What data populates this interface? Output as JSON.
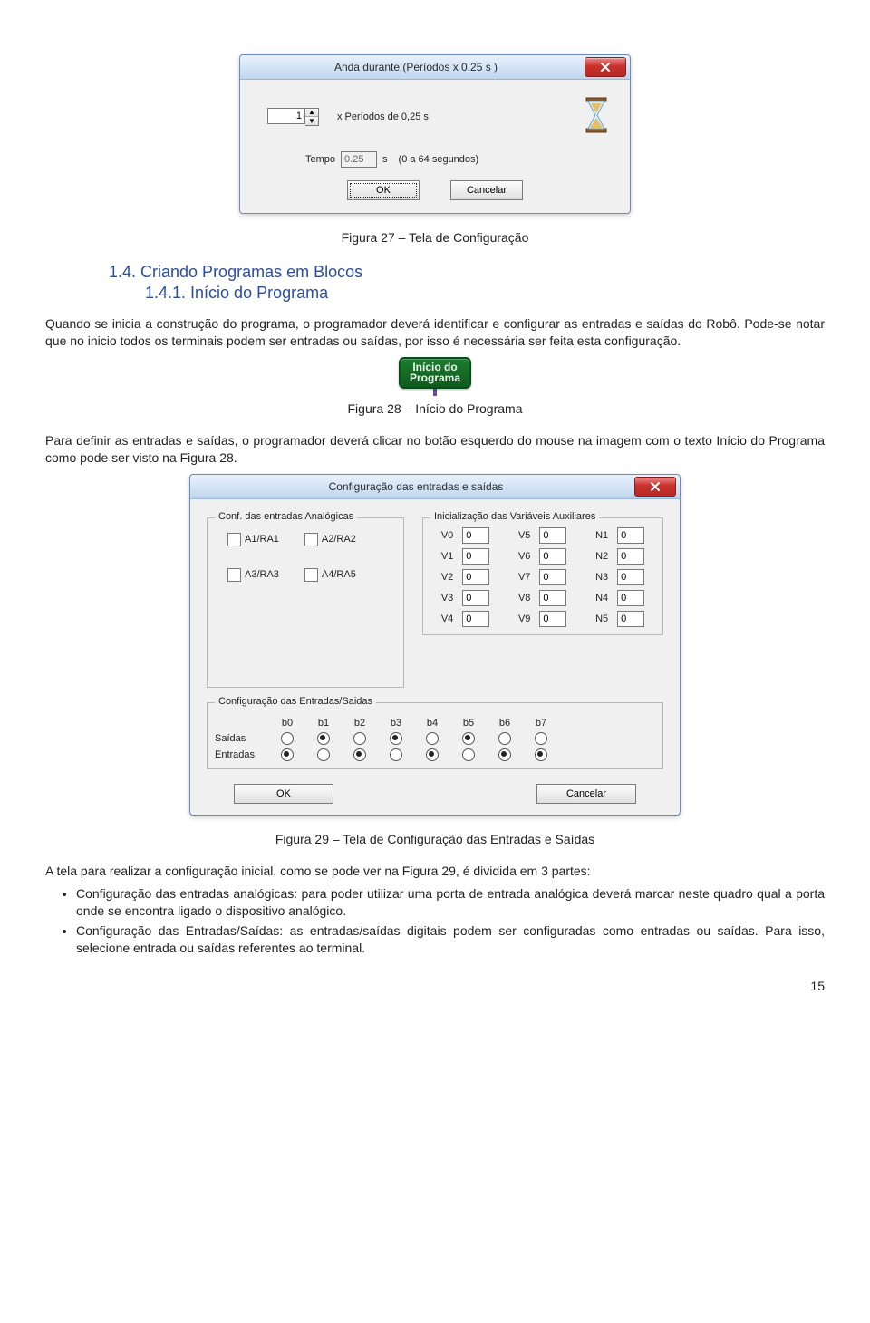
{
  "dialog1": {
    "title": "Anda durante (Períodos x 0.25 s )",
    "period_value": "1",
    "period_label": "x Períodos de 0,25 s",
    "tempo_label": "Tempo",
    "tempo_value": "0.25",
    "tempo_unit": "s",
    "tempo_hint": "(0 a 64 segundos)",
    "ok": "OK",
    "cancel": "Cancelar"
  },
  "caption1": "Figura 27 – Tela de Configuração",
  "heading1": "1.4.    Criando Programas em Blocos",
  "heading2": "1.4.1.    Início do Programa",
  "para1": "Quando se inicia a construção do programa, o programador deverá identificar e configurar as entradas e saídas do Robô. Pode-se notar que no inicio todos os terminais podem ser entradas ou saídas, por isso é necessária ser feita esta configuração.",
  "badge": {
    "line1": "Início do",
    "line2": "Programa"
  },
  "caption2": "Figura 28 – Início do Programa",
  "para2": "Para definir as entradas e saídas, o programador deverá clicar no botão esquerdo do mouse na imagem com o texto Início do Programa como pode ser visto na Figura 28.",
  "dialog2": {
    "title": "Configuração das entradas e saídas",
    "grp_analog": "Conf. das entradas Analógicas",
    "ck": {
      "a1": "A1/RA1",
      "a2": "A2/RA2",
      "a3": "A3/RA3",
      "a4": "A4/RA5"
    },
    "grp_vars": "Inicialização das Variáveis Auxiliares",
    "vars": {
      "V0": "0",
      "V1": "0",
      "V2": "0",
      "V3": "0",
      "V4": "0",
      "V5": "0",
      "V6": "0",
      "V7": "0",
      "V8": "0",
      "V9": "0",
      "N1": "0",
      "N2": "0",
      "N3": "0",
      "N4": "0",
      "N5": "0"
    },
    "grp_io": "Configuração das Entradas/Saidas",
    "bits": [
      "b0",
      "b1",
      "b2",
      "b3",
      "b4",
      "b5",
      "b6",
      "b7"
    ],
    "rows": {
      "saidas": "Saídas",
      "entradas": "Entradas"
    },
    "io_state": {
      "saidas": [
        false,
        true,
        false,
        true,
        false,
        true,
        false,
        false
      ],
      "entradas": [
        true,
        false,
        true,
        false,
        true,
        false,
        true,
        true
      ]
    },
    "ok": "OK",
    "cancel": "Cancelar"
  },
  "caption3": "Figura 29 – Tela de Configuração das Entradas e Saídas",
  "para3": "A tela para realizar a configuração inicial, como se pode ver na Figura 29, é dividida em 3 partes:",
  "bullets": [
    "Configuração das entradas analógicas: para poder utilizar uma porta de entrada analógica deverá marcar neste quadro qual a porta onde se encontra ligado o dispositivo analógico.",
    "Configuração das Entradas/Saídas: as entradas/saídas digitais podem ser configuradas como entradas ou saídas. Para isso, selecione entrada ou saídas referentes ao terminal."
  ],
  "page_number": "15"
}
